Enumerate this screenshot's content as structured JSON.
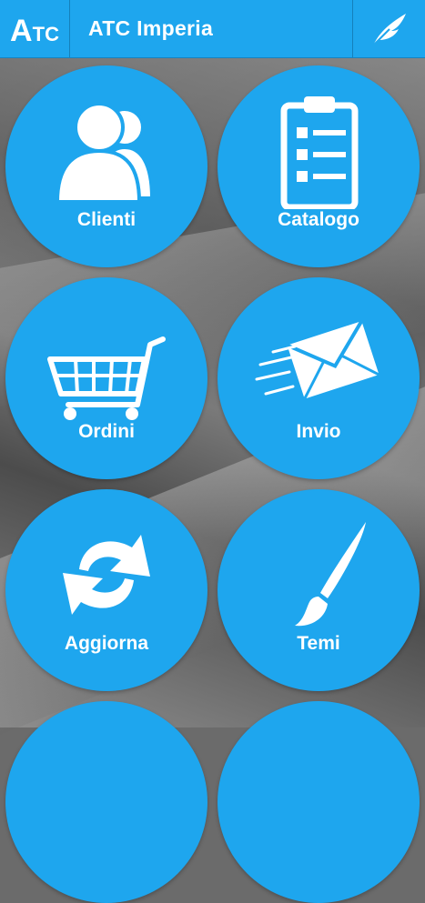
{
  "app": {
    "logo_main": "A",
    "logo_sub_t": "T",
    "logo_sub_c": "C",
    "title": "ATC Imperia",
    "action_icon": "feather-icon"
  },
  "colors": {
    "accent": "#1ea6ee",
    "text": "#ffffff"
  },
  "menu": [
    {
      "label": "Clienti",
      "icon": "users-icon"
    },
    {
      "label": "Catalogo",
      "icon": "clipboard-list-icon"
    },
    {
      "label": "Ordini",
      "icon": "shopping-cart-icon"
    },
    {
      "label": "Invio",
      "icon": "send-mail-icon"
    },
    {
      "label": "Aggiorna",
      "icon": "refresh-icon"
    },
    {
      "label": "Temi",
      "icon": "paintbrush-icon"
    }
  ]
}
